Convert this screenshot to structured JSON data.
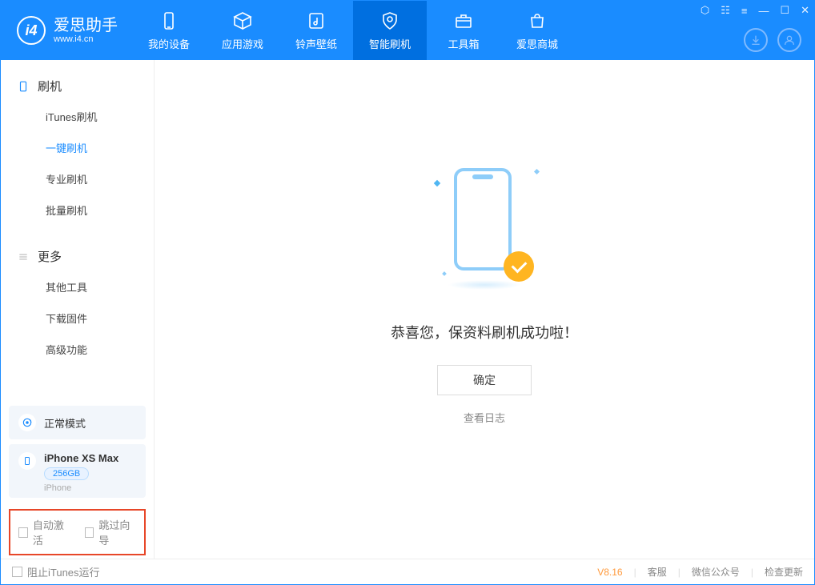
{
  "brand": {
    "name": "爱思助手",
    "url": "www.i4.cn",
    "logo_text": "i4"
  },
  "nav": {
    "tabs": [
      {
        "label": "我的设备",
        "icon": "device"
      },
      {
        "label": "应用游戏",
        "icon": "cube"
      },
      {
        "label": "铃声壁纸",
        "icon": "music"
      },
      {
        "label": "智能刷机",
        "icon": "shield",
        "active": true
      },
      {
        "label": "工具箱",
        "icon": "toolbox"
      },
      {
        "label": "爱思商城",
        "icon": "shop"
      }
    ]
  },
  "window_controls": {
    "settings": "⚙",
    "min": "—",
    "max": "☐",
    "close": "✕",
    "feedback": "⿲",
    "skin": "◇"
  },
  "sidebar": {
    "group1": {
      "title": "刷机",
      "items": [
        {
          "label": "iTunes刷机"
        },
        {
          "label": "一键刷机",
          "active": true
        },
        {
          "label": "专业刷机"
        },
        {
          "label": "批量刷机"
        }
      ]
    },
    "group2": {
      "title": "更多",
      "items": [
        {
          "label": "其他工具"
        },
        {
          "label": "下载固件"
        },
        {
          "label": "高级功能"
        }
      ]
    },
    "mode": {
      "label": "正常模式"
    },
    "device": {
      "name": "iPhone XS Max",
      "capacity": "256GB",
      "type": "iPhone"
    },
    "options": {
      "auto_activate": "自动激活",
      "skip_guide": "跳过向导"
    }
  },
  "main": {
    "success_text": "恭喜您，保资料刷机成功啦！",
    "ok_button": "确定",
    "view_log": "查看日志"
  },
  "statusbar": {
    "block_itunes": "阻止iTunes运行",
    "version": "V8.16",
    "customer_service": "客服",
    "wechat": "微信公众号",
    "check_update": "检查更新"
  }
}
